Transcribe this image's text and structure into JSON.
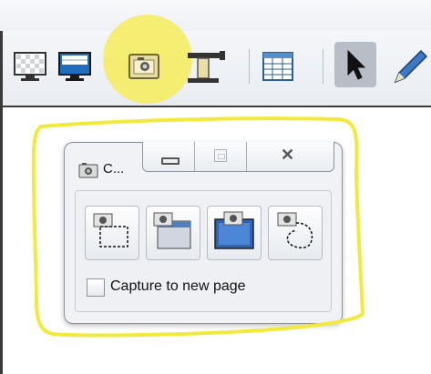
{
  "toolbar": {
    "buttons": [
      {
        "name": "transparent-screen-button",
        "icon": "transparent-screen-icon"
      },
      {
        "name": "screen-shade-button",
        "icon": "screen-shade-icon"
      },
      {
        "name": "screen-capture-button",
        "icon": "camera-icon"
      },
      {
        "name": "spotlight-tool-button",
        "icon": "spotlight-icon"
      },
      {
        "name": "insert-table-button",
        "icon": "table-icon"
      },
      {
        "name": "select-pointer-button",
        "icon": "pointer-icon"
      },
      {
        "name": "pen-button",
        "icon": "pen-icon"
      }
    ],
    "highlight_color": "#f5ec5a"
  },
  "capture_window": {
    "title": "C...",
    "caption_buttons": {
      "minimize": "minimize-icon",
      "maximize": "maximize-icon",
      "close": "close-icon"
    },
    "buttons": [
      {
        "name": "area-capture-button",
        "icon": "rectangle-capture-icon"
      },
      {
        "name": "window-capture-button",
        "icon": "window-capture-icon"
      },
      {
        "name": "fullscreen-capture-button",
        "icon": "fullscreen-capture-icon"
      },
      {
        "name": "freehand-capture-button",
        "icon": "freehand-capture-icon"
      }
    ],
    "checkbox_label": "Capture to new page",
    "checkbox_checked": false
  },
  "annotation": {
    "outline_color": "#f2ea3a"
  }
}
